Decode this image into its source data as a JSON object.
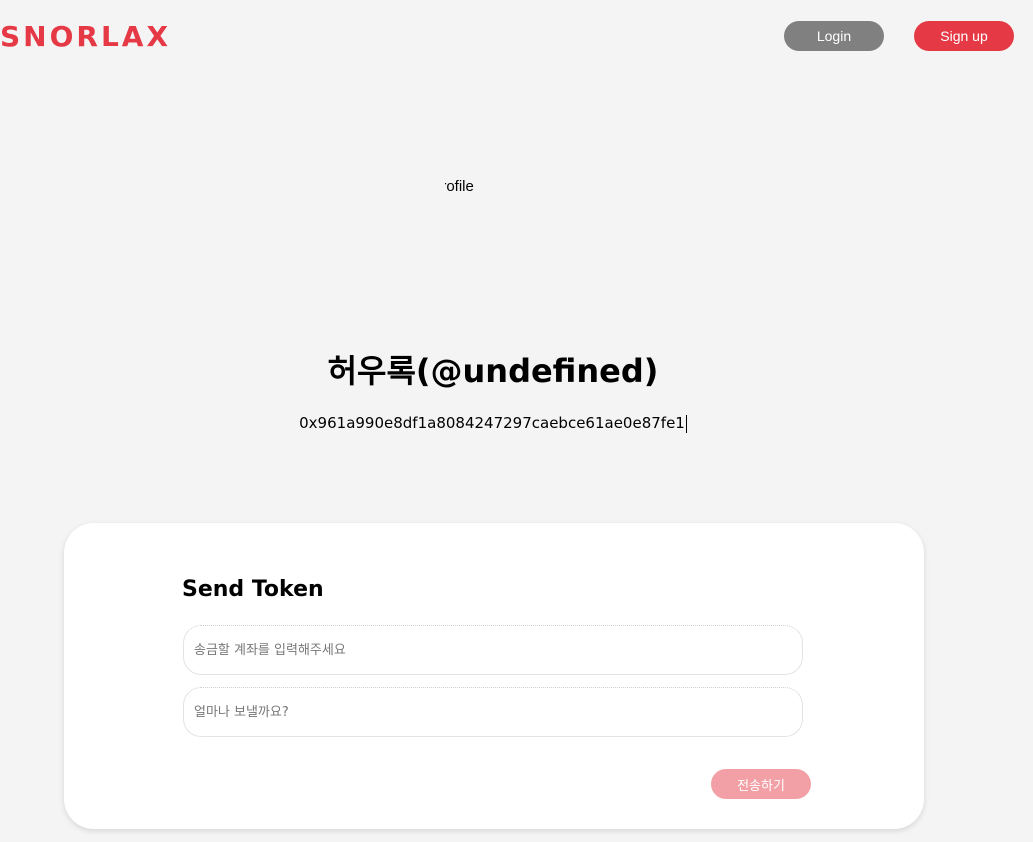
{
  "header": {
    "logo_text": "SNORLAX",
    "login_label": "Login",
    "signup_label": "Sign up"
  },
  "profile": {
    "image_alt": "profile",
    "name": "허우록(@undefined)",
    "wallet_address": "0x961a990e8df1a8084247297caebce61ae0e87fe1"
  },
  "send_token": {
    "title": "Send Token",
    "account_placeholder": "송금할 계좌를 입력해주세요",
    "amount_placeholder": "얼마나 보낼까요?",
    "submit_label": "전송하기"
  },
  "colors": {
    "brand": "#e63946",
    "login_button": "#808080",
    "submit_button_disabled": "#f2a0a6",
    "background": "#f4f4f4"
  }
}
